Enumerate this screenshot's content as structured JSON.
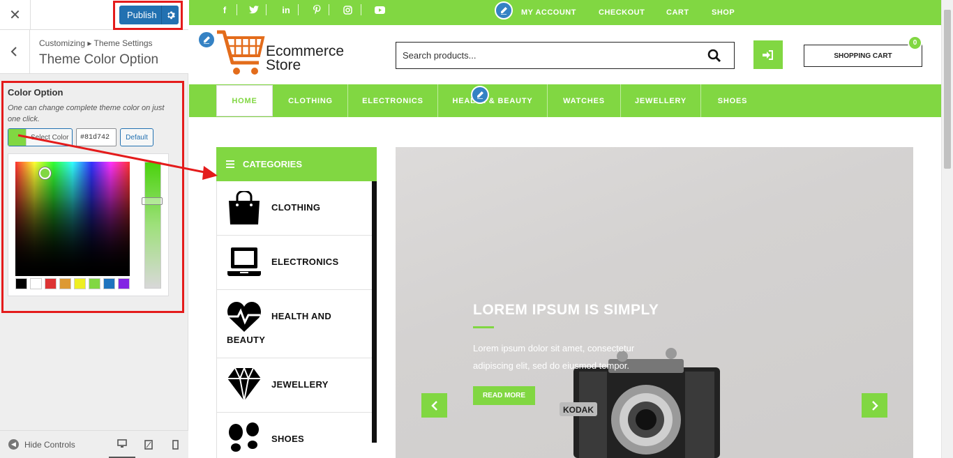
{
  "sidebar": {
    "close_glyph": "✕",
    "publish_label": "Publish",
    "breadcrumb": "Customizing ▸ Theme Settings",
    "section_title": "Theme Color Option",
    "color_option": {
      "title": "Color Option",
      "description": "One can change complete theme color on just one click.",
      "select_label": "Select Color",
      "hex_value": "#81d742",
      "default_label": "Default",
      "current_color": "#81d742",
      "palette": [
        "#000000",
        "#ffffff",
        "#dd3333",
        "#dd9933",
        "#eeee22",
        "#81d742",
        "#1e73be",
        "#8224e3"
      ]
    },
    "footer": {
      "hide_controls": "Hide Controls"
    }
  },
  "preview": {
    "top_links": [
      "MY ACCOUNT",
      "CHECKOUT",
      "CART",
      "SHOP"
    ],
    "social_icons": [
      "facebook-icon",
      "twitter-icon",
      "linkedin-icon",
      "pinterest-icon",
      "instagram-icon",
      "youtube-icon"
    ],
    "logo": {
      "line1": "Ecommerce",
      "line2": "Store"
    },
    "search_placeholder": "Search products...",
    "cart_label": "SHOPPING CART",
    "cart_count": "0",
    "nav": [
      "HOME",
      "CLOTHING",
      "ELECTRONICS",
      "HEALTH & BEAUTY",
      "WATCHES",
      "JEWELLERY",
      "SHOES"
    ],
    "categories_title": "CATEGORIES",
    "categories": [
      {
        "label": "CLOTHING",
        "icon": "shopping-bag-icon"
      },
      {
        "label": "ELECTRONICS",
        "icon": "laptop-icon"
      },
      {
        "label": "HEALTH AND BEAUTY",
        "icon": "heartbeat-icon"
      },
      {
        "label": "JEWELLERY",
        "icon": "diamond-icon"
      },
      {
        "label": "SHOES",
        "icon": "shoe-prints-icon"
      }
    ],
    "slide": {
      "title": "LOREM IPSUM IS SIMPLY",
      "text": "Lorem ipsum dolor sit amet, consectetur adipiscing elit, sed do eiusmod tempor.",
      "button": "READ MORE",
      "camera_brand": "KODAK"
    },
    "accent_color": "#81d742"
  }
}
